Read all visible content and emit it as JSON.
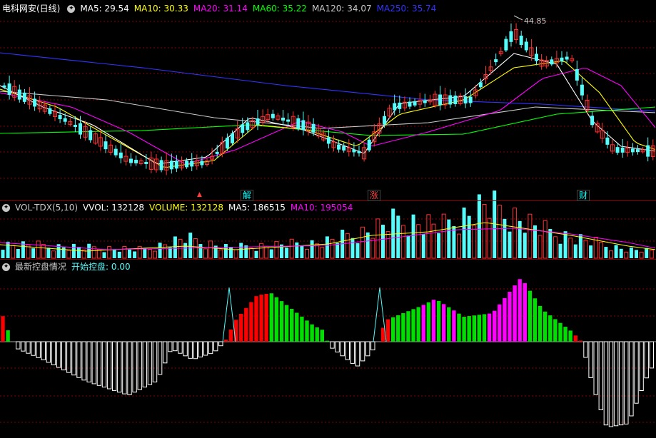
{
  "price_panel": {
    "title": "电科网安(日线)",
    "ma5": "MA5: 29.54",
    "ma10": "MA10: 30.33",
    "ma20": "MA20: 31.14",
    "ma60": "MA60: 35.22",
    "ma120": "MA120: 34.07",
    "ma250": "MA250: 35.74",
    "high_label": "44.85",
    "markers": [
      {
        "label": "▲",
        "color": "#ff4040"
      },
      {
        "label": "解",
        "color": "#00ffff"
      },
      {
        "label": "涨",
        "color": "#ff4040"
      },
      {
        "label": "财",
        "color": "#00ffff"
      }
    ]
  },
  "volume_panel": {
    "name": "VOL-TDX(5,10)",
    "vvol": "VVOL: 132128",
    "volume": "VOLUME: 132128",
    "ma5": "MA5: 186515",
    "ma10": "MA10: 195054"
  },
  "control_panel": {
    "name": "最新控盘情况",
    "start": "开始控盘: 0.00"
  },
  "colors": {
    "up": "#ff3232",
    "down": "#54fcfc",
    "ma5": "#ffffff",
    "ma10": "#ffff00",
    "ma20": "#ff00ff",
    "ma60": "#00ff00",
    "ma120": "#c8c8c8",
    "ma250": "#3333ff",
    "grid": "#8a0000",
    "bar_red": "#ff0000",
    "bar_green": "#00e000",
    "bar_magenta": "#ff00ff",
    "bar_white": "#ffffff"
  },
  "chart_data": [
    {
      "type": "candlestick",
      "title": "电科网安(日线)",
      "series": [
        {
          "name": "MA5",
          "last": 29.54
        },
        {
          "name": "MA10",
          "last": 30.33
        },
        {
          "name": "MA20",
          "last": 31.14
        },
        {
          "name": "MA60",
          "last": 35.22
        },
        {
          "name": "MA120",
          "last": 34.07
        },
        {
          "name": "MA250",
          "last": 35.74
        }
      ],
      "annotations": [
        {
          "label": "44.85"
        }
      ]
    },
    {
      "type": "bar",
      "title": "VOL-TDX(5,10)",
      "series": [
        {
          "name": "VVOL",
          "last": 132128
        },
        {
          "name": "VOLUME",
          "last": 132128
        },
        {
          "name": "MA5",
          "last": 186515
        },
        {
          "name": "MA10",
          "last": 195054
        }
      ]
    },
    {
      "type": "bar",
      "title": "最新控盘情况",
      "series": [
        {
          "name": "开始控盘",
          "last": 0.0
        }
      ]
    }
  ]
}
